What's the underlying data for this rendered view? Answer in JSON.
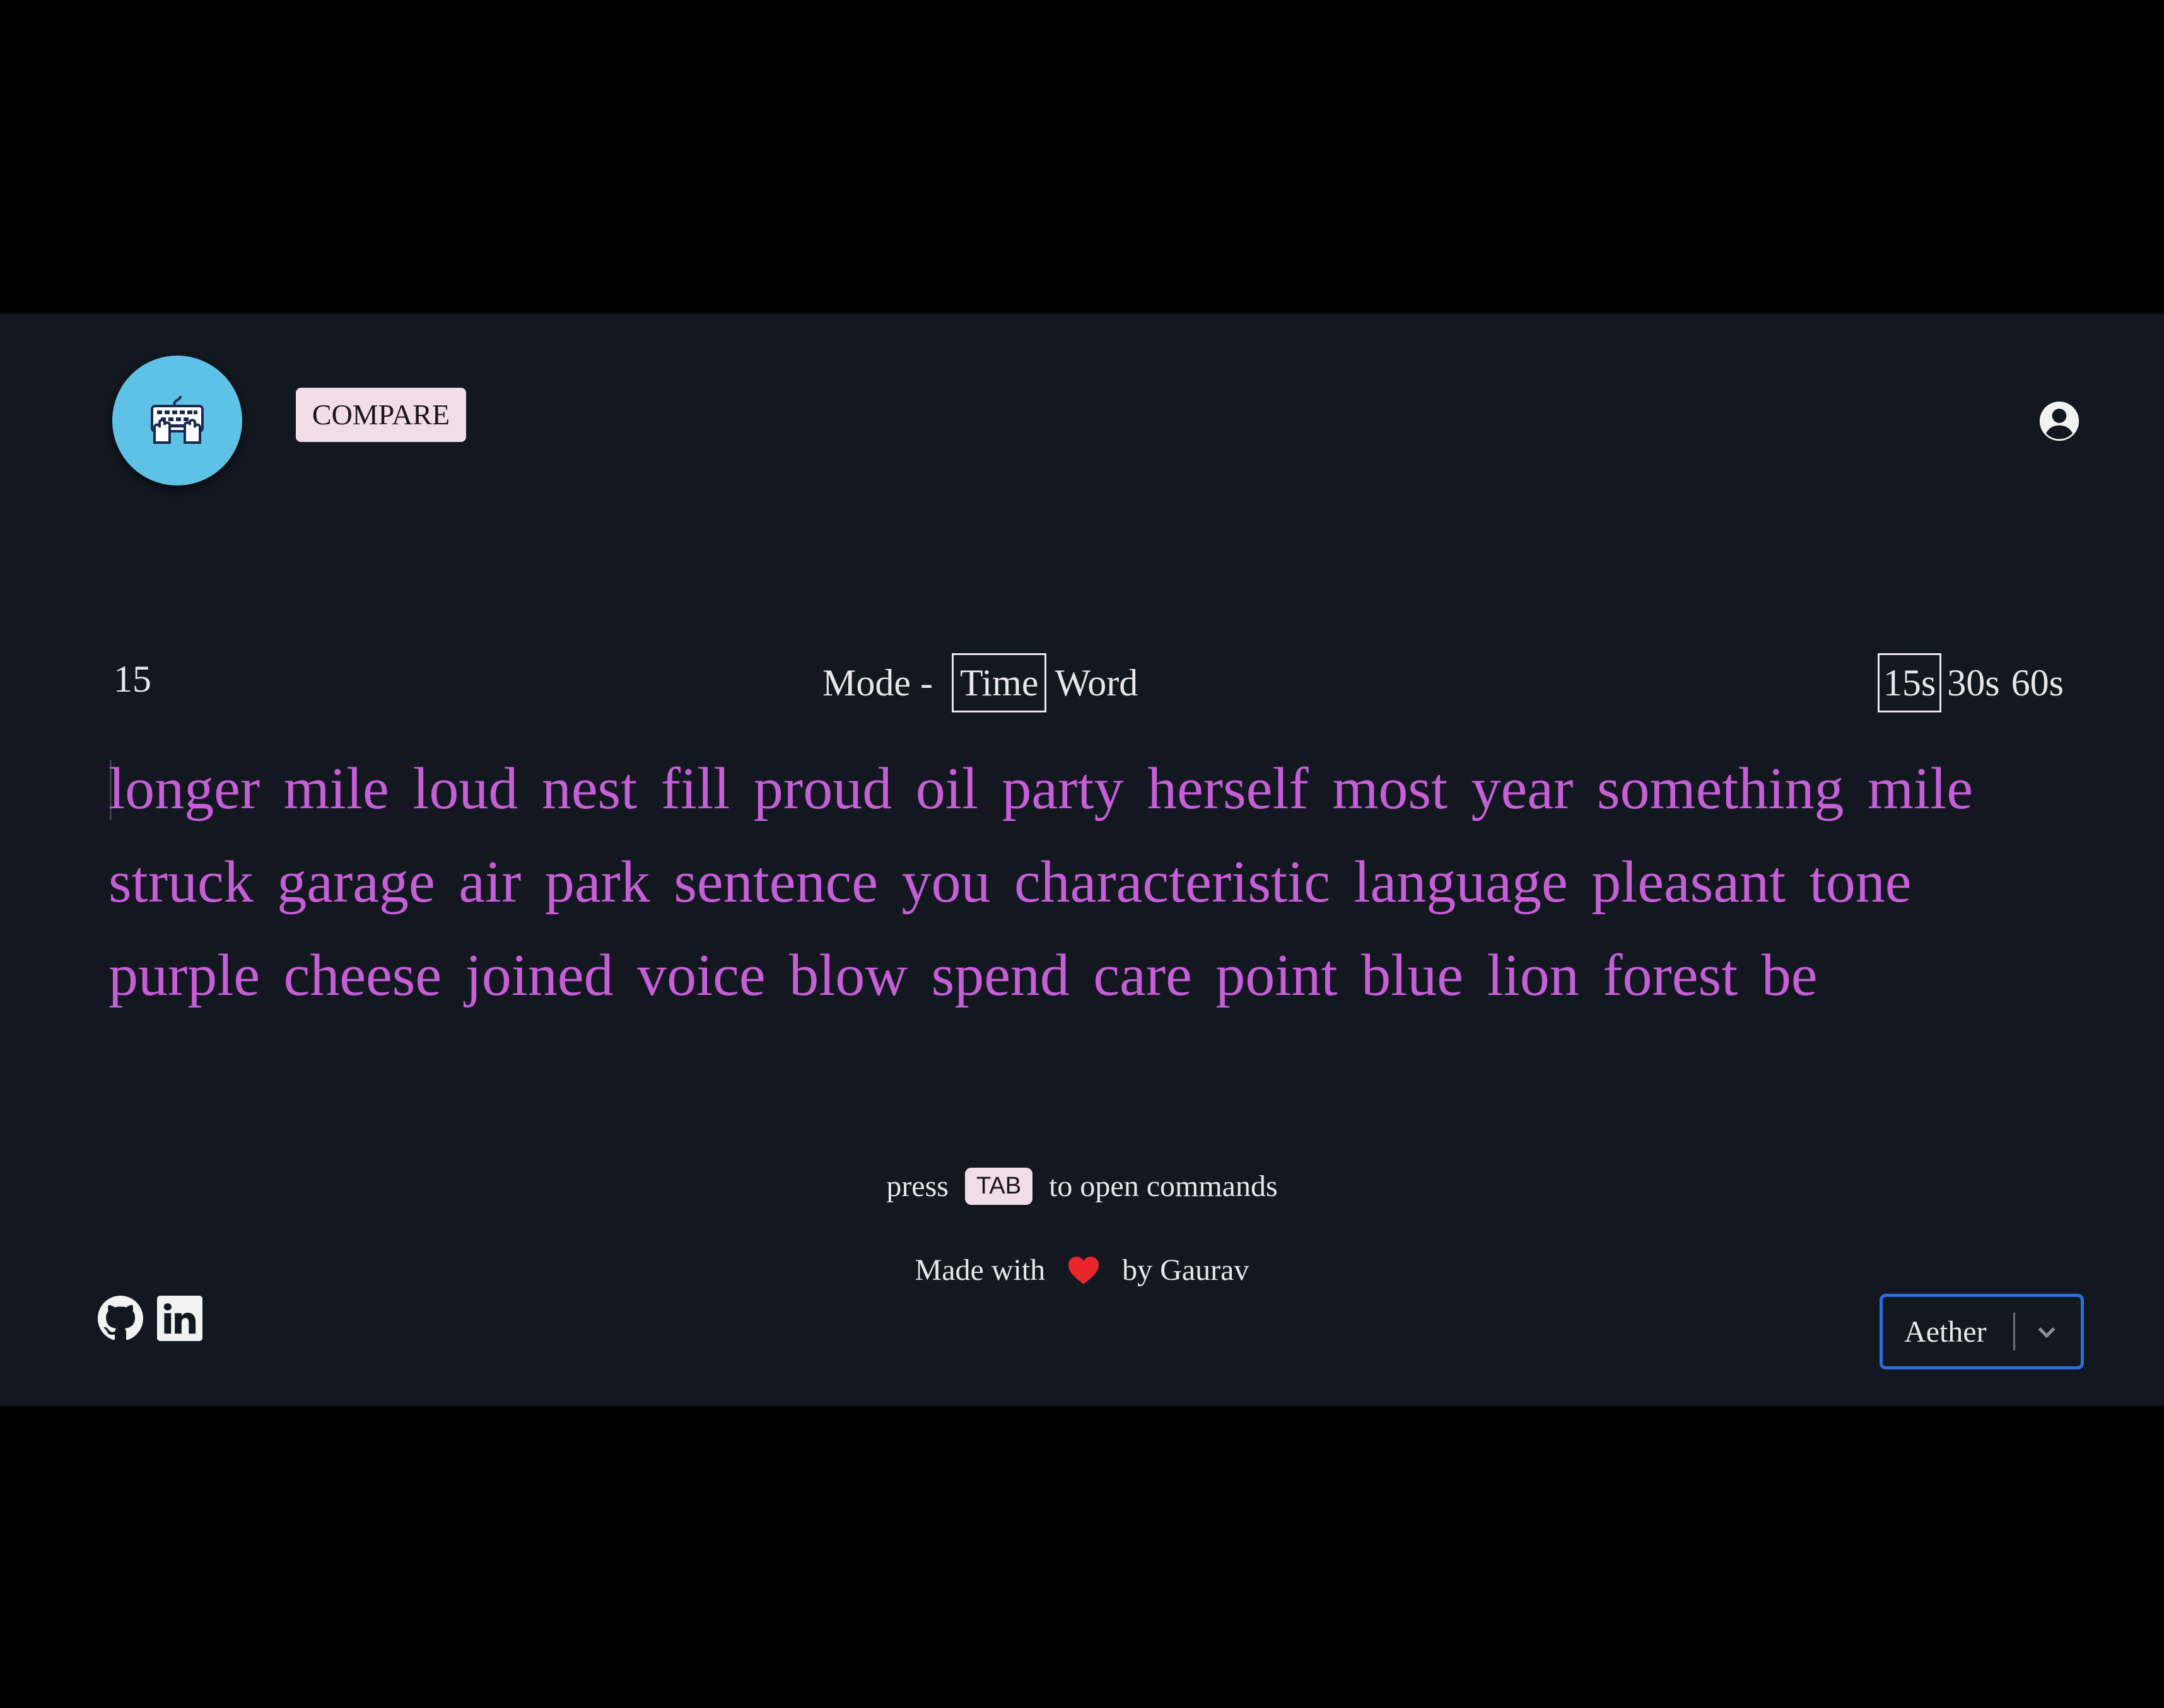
{
  "header": {
    "logo_icon": "keyboard-typing-icon",
    "compare_label": "COMPARE",
    "profile_icon": "user-circle-icon"
  },
  "status": {
    "countdown": "15"
  },
  "mode": {
    "label": "Mode -",
    "options": [
      "Time",
      "Word"
    ],
    "selected": "Time"
  },
  "time_options": {
    "options": [
      "15s",
      "30s",
      "60s"
    ],
    "selected": "15s"
  },
  "words": {
    "text": "longer mile loud nest fill proud oil party herself most year something mile struck garage air park sentence you characteristic language pleasant tone purple cheese joined voice blow spend care point blue lion forest be"
  },
  "hint": {
    "before": "press",
    "key": "TAB",
    "after": "to open commands"
  },
  "footer": {
    "made_with": "Made with",
    "by": "by Gaurav",
    "social_icons": [
      "github-icon",
      "linkedin-icon"
    ],
    "theme_value": "Aether"
  },
  "colors": {
    "background": "#131820",
    "word_color": "#c65ed8",
    "logo_bg": "#5ec2e6",
    "button_bg": "#f1dce9",
    "select_border": "#2a6fe0",
    "heart": "#e8262b"
  }
}
